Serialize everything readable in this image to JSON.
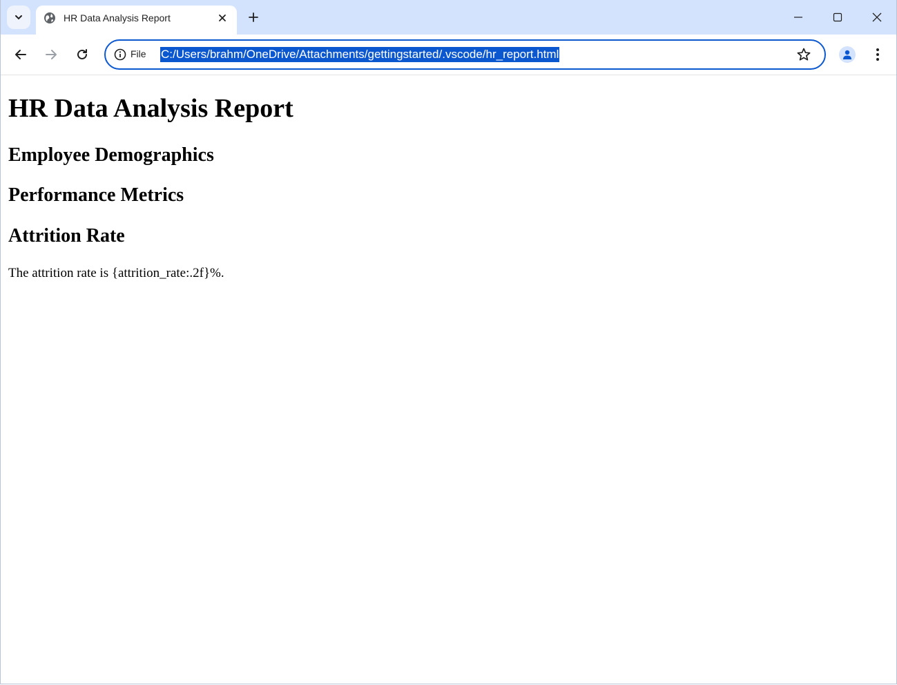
{
  "browser": {
    "tab": {
      "title": "HR Data Analysis Report",
      "icon": "globe-icon"
    },
    "address_bar": {
      "scheme_label": "File",
      "url": "C:/Users/brahm/OneDrive/Attachments/gettingstarted/.vscode/hr_report.html"
    },
    "accent_color": "#0b57d0",
    "tabstrip_color": "#d3e3fd"
  },
  "page": {
    "title": "HR Data Analysis Report",
    "sections": [
      {
        "heading": "Employee Demographics"
      },
      {
        "heading": "Performance Metrics"
      },
      {
        "heading": "Attrition Rate"
      }
    ],
    "attrition_text": "The attrition rate is {attrition_rate:.2f}%."
  }
}
